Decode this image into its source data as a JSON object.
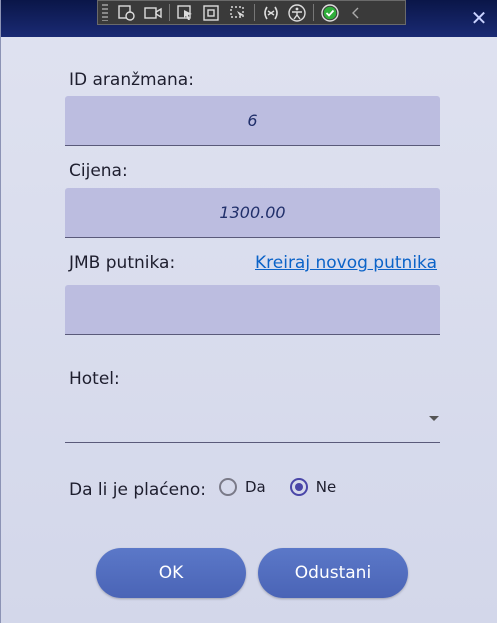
{
  "titlebar": {
    "close_icon": "close-icon"
  },
  "toolbar": {
    "icons": [
      "select-element-icon",
      "video-icon",
      "pointer-icon",
      "frame-icon",
      "element-icon",
      "binding-icon",
      "accessibility-icon",
      "check-icon",
      "collapse-icon"
    ]
  },
  "form": {
    "id_label": "ID aranžmana:",
    "id_value": "6",
    "price_label": "Cijena:",
    "price_value": "1300.00",
    "jmb_label": "JMB putnika:",
    "create_link": "Kreiraj novog putnika",
    "jmb_value": "",
    "hotel_label": "Hotel:",
    "hotel_value": "",
    "paid_label": "Da li je plaćeno:",
    "paid_options": [
      {
        "label": "Da",
        "checked": false
      },
      {
        "label": "Ne",
        "checked": true
      }
    ]
  },
  "buttons": {
    "ok": "OK",
    "cancel": "Odustani"
  },
  "colors": {
    "titlebar": "#0a1648",
    "field_bg": "#bcbde0",
    "button": "#5b78c8",
    "link": "#0b63c8",
    "radio_checked": "#4a46a8"
  }
}
